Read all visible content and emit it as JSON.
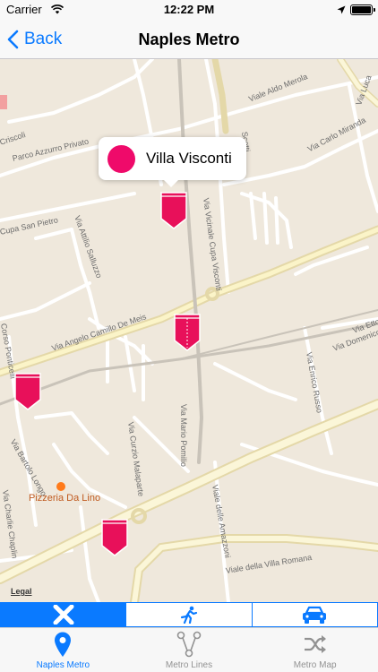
{
  "status_bar": {
    "carrier": "Carrier",
    "time": "12:22 PM",
    "battery_level": 1.0
  },
  "nav": {
    "back_label": "Back",
    "title": "Naples Metro"
  },
  "map": {
    "callout": {
      "station_name": "Villa Visconti",
      "color": "#ef0a6a"
    },
    "pin_color": "#e8105a",
    "streets": [
      "Viale Aldo Merola",
      "Parco Azzurro Privato",
      "Via Vicinale Cupa Visconti",
      "Via Carlo Miranda",
      "Cupa San Pietro",
      "Via Attilio Salluzzo",
      "Via Angelo Camillo De Meis",
      "Corso Ponticelli",
      "Via Bartolo Longo",
      "Via Curzio Malaparte",
      "Via Mario Pomilio",
      "Via Enrico Russo",
      "Viale delle Amazzoni",
      "Viale della Villa Romana",
      "Via Charlie Chaplin",
      "Via Domenico",
      "Via Ettore",
      "Scotti",
      "Criscoli",
      "Via Luca"
    ],
    "poi": {
      "name": "Pizzeria Da Lino",
      "color": "#ff7a1a"
    },
    "legal": "Legal"
  },
  "transport_modes": [
    {
      "icon": "close-icon",
      "selected": true
    },
    {
      "icon": "walking-icon",
      "selected": false
    },
    {
      "icon": "car-icon",
      "selected": false
    }
  ],
  "tabs": [
    {
      "label": "Naples Metro",
      "icon": "map-pin-icon",
      "active": true
    },
    {
      "label": "Metro Lines",
      "icon": "lines-icon",
      "active": false
    },
    {
      "label": "Metro Map",
      "icon": "shuffle-icon",
      "active": false
    }
  ],
  "colors": {
    "accent": "#0a7aff",
    "station": "#ef0a6a",
    "map_bg": "#efe8dc"
  }
}
